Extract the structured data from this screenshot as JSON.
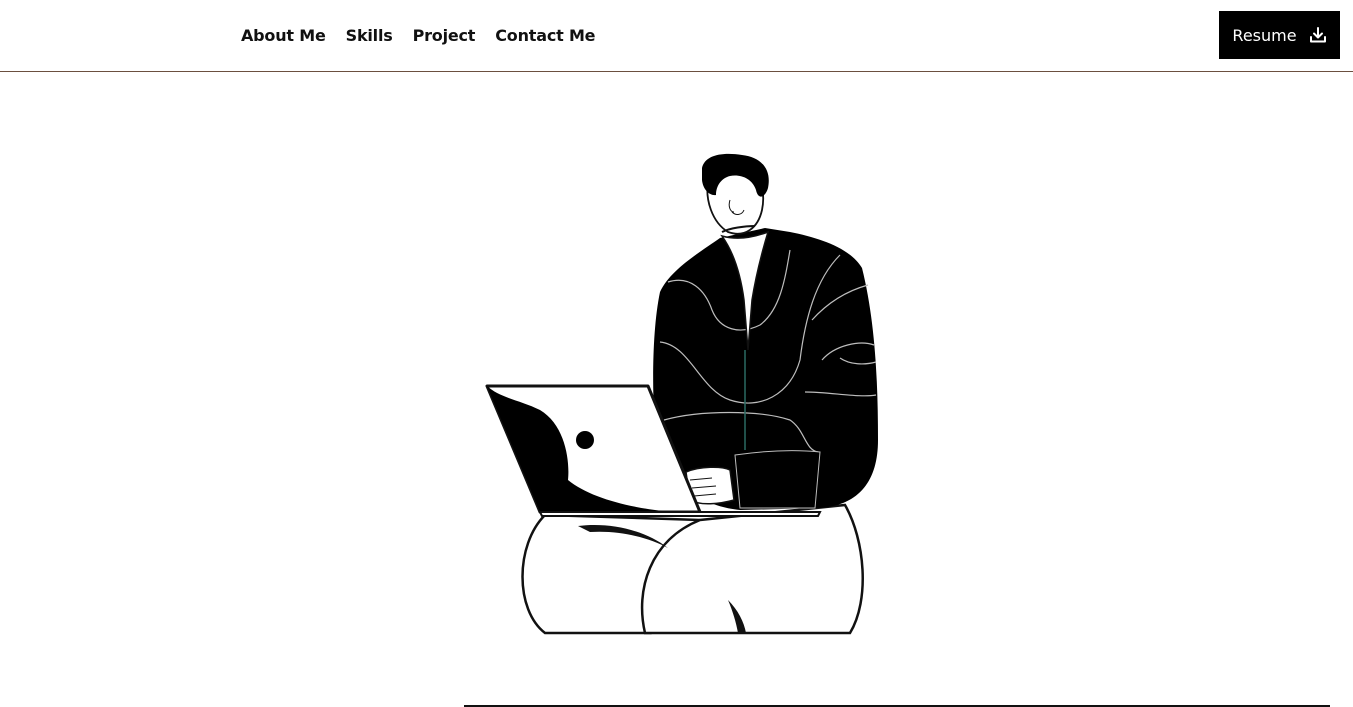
{
  "nav": {
    "links": [
      {
        "label": "About Me"
      },
      {
        "label": "Skills"
      },
      {
        "label": "Project"
      },
      {
        "label": "Contact Me"
      }
    ],
    "resume_label": "Resume",
    "resume_icon": "download-icon"
  },
  "hero": {
    "illustration": "person-with-laptop-illustration"
  },
  "colors": {
    "primary": "#000000",
    "background": "#ffffff",
    "nav_border": "#6b4f3f"
  }
}
